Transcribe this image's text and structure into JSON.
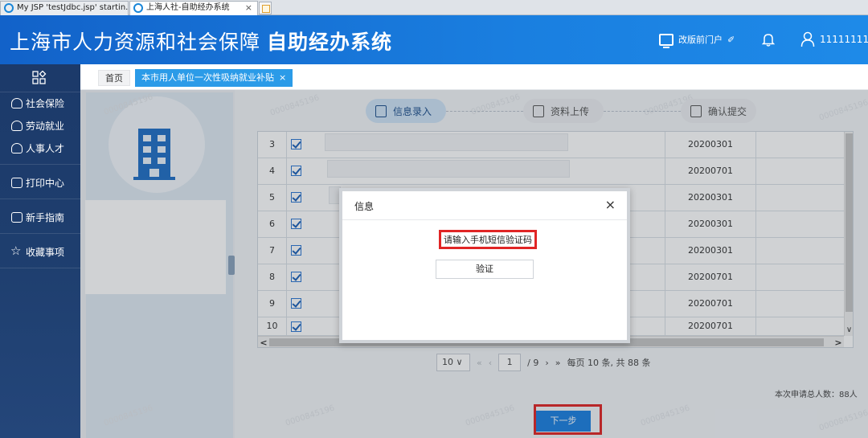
{
  "browser": {
    "tabs": [
      {
        "label": "My JSP 'testJdbc.jsp' startin...",
        "active": false
      },
      {
        "label": "上海人社-自助经办系统",
        "active": true
      }
    ]
  },
  "header": {
    "title": "上海市人力资源和社会保障",
    "title_bold": "自助经办系统",
    "portal_label": "改版前门户",
    "user_name": "11111111",
    "colors": {
      "primary": "#1a7fe0",
      "sidebar": "#1e3e6e",
      "highlight": "#e02525"
    }
  },
  "sidebar": {
    "items": [
      {
        "label": "社会保险",
        "icon": "umbrella-icon"
      },
      {
        "label": "劳动就业",
        "icon": "worker-icon"
      },
      {
        "label": "人事人才",
        "icon": "people-icon"
      },
      {
        "label": "打印中心",
        "icon": "printer-icon"
      },
      {
        "label": "新手指南",
        "icon": "guide-icon"
      },
      {
        "label": "收藏事项",
        "icon": "star-icon"
      }
    ]
  },
  "breadcrumb": {
    "home": "首页",
    "active_tab": "本市用人单位一次性吸纳就业补贴"
  },
  "steps": [
    {
      "label": "信息录入",
      "active": true
    },
    {
      "label": "资料上传",
      "active": false
    },
    {
      "label": "确认提交",
      "active": false
    }
  ],
  "table": {
    "rows": [
      {
        "num": "3",
        "date": "20200301"
      },
      {
        "num": "4",
        "date": "20200701"
      },
      {
        "num": "5",
        "date": "20200301"
      },
      {
        "num": "6",
        "date": "20200301"
      },
      {
        "num": "7",
        "date": "20200301"
      },
      {
        "num": "8",
        "date": "20200701"
      },
      {
        "num": "9",
        "date": "20200701"
      },
      {
        "num": "10",
        "date": "20200701"
      }
    ]
  },
  "pager": {
    "page_size": "10",
    "current_page": "1",
    "total_pages": "/ 9",
    "summary": "每页 10 条, 共 88 条"
  },
  "total_count": "本次申请总人数：88人",
  "next_button": "下一步",
  "modal": {
    "title": "信息",
    "message": "请输入手机短信验证码",
    "verify_button": "验证"
  },
  "watermark_text": "0000845196"
}
